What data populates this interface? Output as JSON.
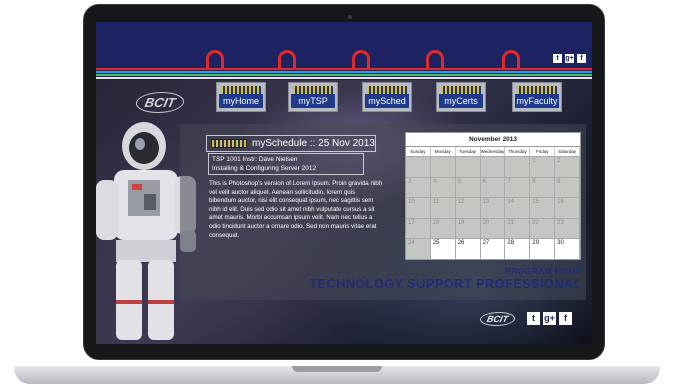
{
  "nav": {
    "items": [
      {
        "label": "myHome"
      },
      {
        "label": "myTSP"
      },
      {
        "label": "mySched"
      },
      {
        "label": "myCerts"
      },
      {
        "label": "myFaculty"
      }
    ]
  },
  "header": {
    "logo": "BCIT",
    "social": [
      {
        "icon": "twitter-icon",
        "glyph": "t"
      },
      {
        "icon": "google-plus-icon",
        "glyph": "g+"
      },
      {
        "icon": "facebook-icon",
        "glyph": "f"
      }
    ]
  },
  "schedule": {
    "title": "mySchedule :: 25 Nov 2013",
    "course_line1": "TSP 1001 Instr: Dave Nielsen",
    "course_line2": "Installing & Configuring Server 2012",
    "body": "This is Photoshop's version of Lorem Ipsum. Proin gravida nibh vel velit auctor aliquet. Aenean sollicitudin, lorem quis bibendum auctor, nisi elit consequat ipsum, nec sagittis sem nibh id elit. Duis sed odio sit amet nibh vulputate cursus a sit amet mauris. Morbi accumsan ipsum velit. Nam nec tellus a odio tincidunt auctor a ornare odio. Sed non mauris vitae erat consequat."
  },
  "calendar": {
    "month": "November 2013",
    "weekdays": [
      "Sunday",
      "Monday",
      "Tuesday",
      "Wednesday",
      "Thursday",
      "Friday",
      "Saturday"
    ],
    "weeks": [
      [
        "",
        "",
        "",
        "",
        "",
        "1",
        "2"
      ],
      [
        "3",
        "4",
        "5",
        "6",
        "7",
        "8",
        "9"
      ],
      [
        "10",
        "11",
        "12",
        "13",
        "14",
        "15",
        "16"
      ],
      [
        "17",
        "18",
        "19",
        "20",
        "21",
        "22",
        "23"
      ],
      [
        "24",
        "25",
        "26",
        "27",
        "28",
        "29",
        "30"
      ]
    ],
    "today": "25"
  },
  "program": {
    "home_label": "PROGRAM HOME",
    "name": "TECHNOLOGY SUPPORT PROFESSIONAL"
  },
  "footer": {
    "logo": "BCIT",
    "social": [
      {
        "icon": "twitter-icon",
        "glyph": "t"
      },
      {
        "icon": "google-plus-icon",
        "glyph": "g+"
      },
      {
        "icon": "facebook-icon",
        "glyph": "f"
      }
    ]
  },
  "colors": {
    "header_bg": "#1d2261",
    "accent_red": "#e02a2a",
    "stripe_blue": "#2f9ee0",
    "stripe_green": "#4bbf5a",
    "title_blue": "#1f2a78"
  }
}
